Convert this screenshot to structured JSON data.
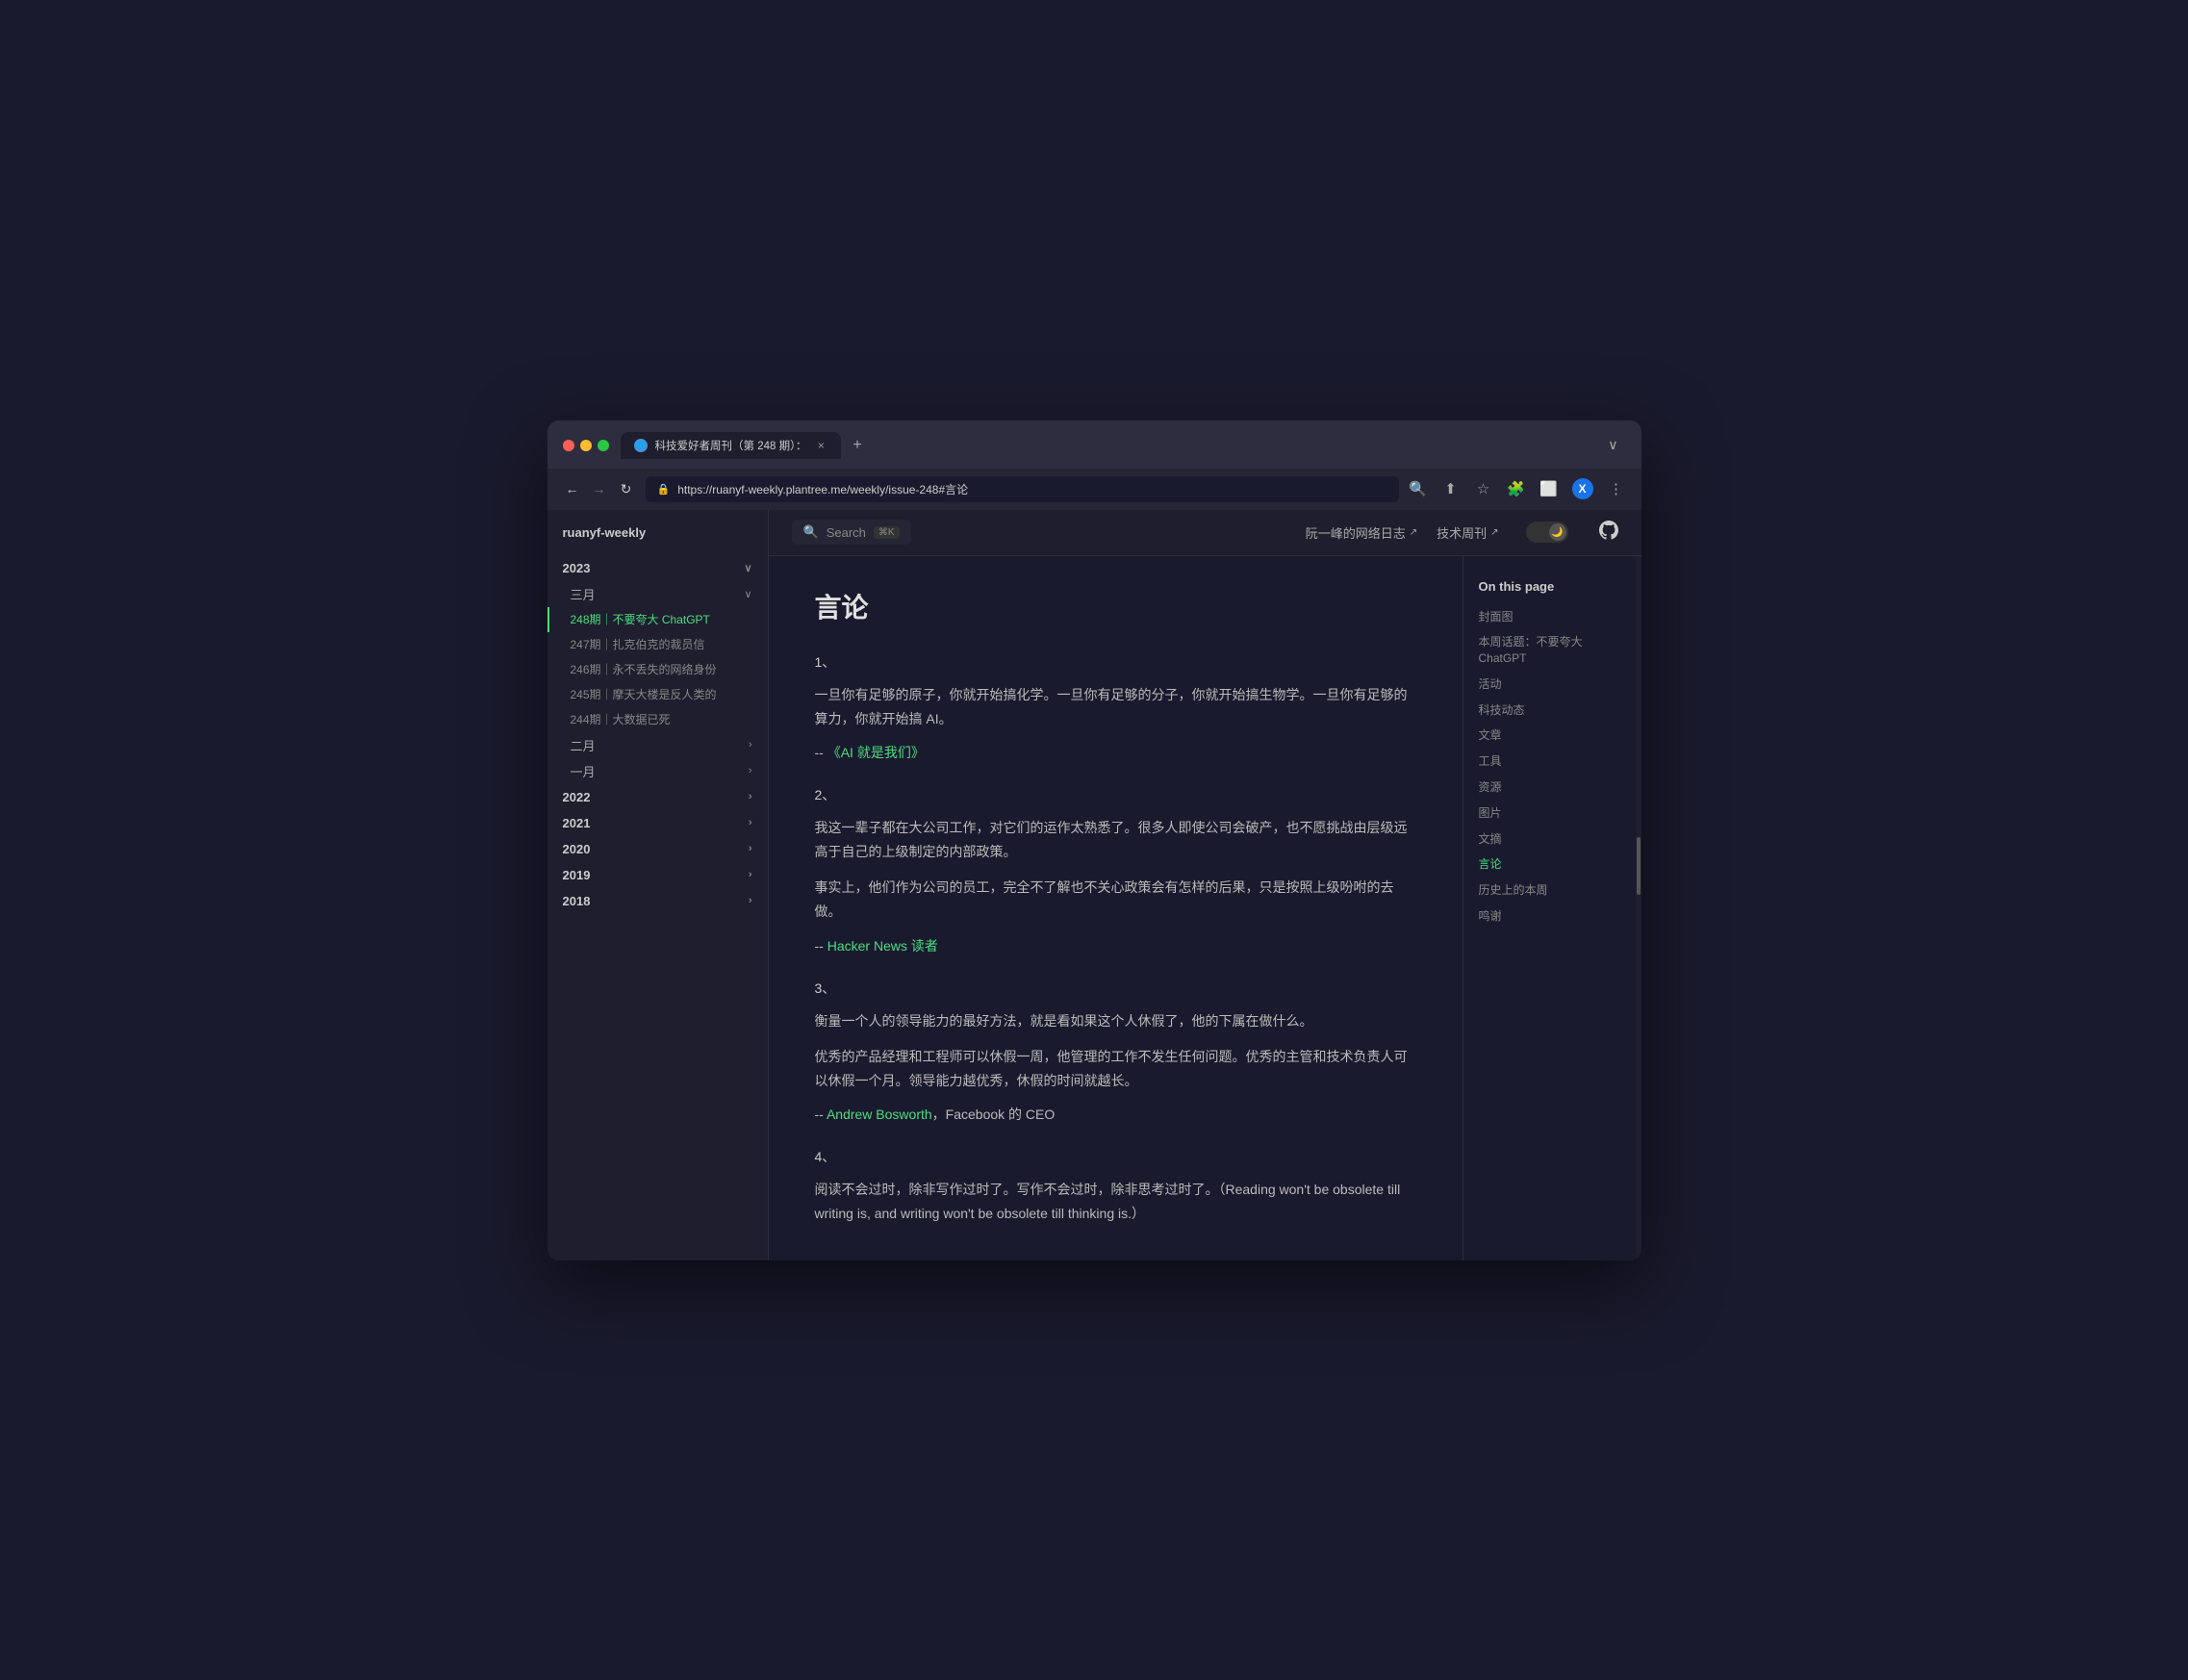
{
  "browser": {
    "tab_title": "科技爱好者周刊（第 248 期）：",
    "tab_close": "×",
    "tab_new": "+",
    "tab_collapse": "∨",
    "nav_back": "←",
    "nav_forward": "→",
    "nav_refresh": "↻",
    "url_lock": "🔒",
    "url": "https://ruanyf-weekly.plantree.me/weekly/issue-248#言论",
    "toolbar": {
      "search": "🔍",
      "share": "⬆",
      "bookmark": "☆",
      "extensions": "🧩",
      "split": "⬜",
      "profile": "X",
      "menu": "⋮"
    }
  },
  "sidebar": {
    "logo": "ruanyf-weekly",
    "years": [
      {
        "label": "2023",
        "expanded": true,
        "months": [
          {
            "label": "三月",
            "expanded": true,
            "items": [
              {
                "label": "248期｜不要夸大 ChatGPT",
                "active": true
              },
              {
                "label": "247期｜扎克伯克的裁员信"
              },
              {
                "label": "246期｜永不丢失的网络身份"
              },
              {
                "label": "245期｜摩天大楼是反人类的"
              },
              {
                "label": "244期｜大数据已死"
              }
            ]
          },
          {
            "label": "二月",
            "expanded": false,
            "items": []
          },
          {
            "label": "一月",
            "expanded": false,
            "items": []
          }
        ]
      },
      {
        "label": "2022",
        "expanded": false
      },
      {
        "label": "2021",
        "expanded": false
      },
      {
        "label": "2020",
        "expanded": false
      },
      {
        "label": "2019",
        "expanded": false
      },
      {
        "label": "2018",
        "expanded": false
      }
    ]
  },
  "topnav": {
    "search_placeholder": "Search",
    "search_kbd": "⌘K",
    "link1_label": "阮一峰的网络日志",
    "link1_ext": "↗",
    "link2_label": "技术周刊",
    "link2_ext": "↗",
    "theme_icon": "🌙"
  },
  "main": {
    "page_title": "言论",
    "sections": [
      {
        "num": "1、",
        "paragraphs": [
          "一旦你有足够的原子，你就开始搞化学。一旦你有足够的分子，你就开始搞生物学。一旦你有足够的算力，你就开始搞 AI。"
        ],
        "attribution": "-- 《AI 就是我们》",
        "attr_link": true
      },
      {
        "num": "2、",
        "paragraphs": [
          "我这一辈子都在大公司工作，对它们的运作太熟悉了。很多人即使公司会破产，也不愿挑战由层级远高于自己的上级制定的内部政策。",
          "事实上，他们作为公司的员工，完全不了解也不关心政策会有怎样的后果，只是按照上级吩咐的去做。"
        ],
        "attribution": "-- Hacker News 读者",
        "attr_link": true
      },
      {
        "num": "3、",
        "paragraphs": [
          "衡量一个人的领导能力的最好方法，就是看如果这个人休假了，他的下属在做什么。",
          "优秀的产品经理和工程师可以休假一周，他管理的工作不发生任何问题。优秀的主管和技术负责人可以休假一个月。领导能力越优秀，休假的时间就越长。"
        ],
        "attribution": "-- Andrew Bosworth，Facebook 的 CEO",
        "attr_link": true,
        "attr_link_text": "Andrew Bosworth"
      },
      {
        "num": "4、",
        "paragraphs": [
          "阅读不会过时，除非写作过时了。写作不会过时，除非思考过时了。（Reading won't be obsolete till writing is, and writing won't be obsolete till thinking is.）"
        ]
      }
    ]
  },
  "toc": {
    "title": "On this page",
    "items": [
      {
        "label": "封面图"
      },
      {
        "label": "本周话题：不要夸大 ChatGPT"
      },
      {
        "label": "活动"
      },
      {
        "label": "科技动态"
      },
      {
        "label": "文章"
      },
      {
        "label": "工具"
      },
      {
        "label": "资源"
      },
      {
        "label": "图片"
      },
      {
        "label": "文摘"
      },
      {
        "label": "言论",
        "active": true
      },
      {
        "label": "历史上的本周"
      },
      {
        "label": "鸣谢"
      }
    ]
  }
}
